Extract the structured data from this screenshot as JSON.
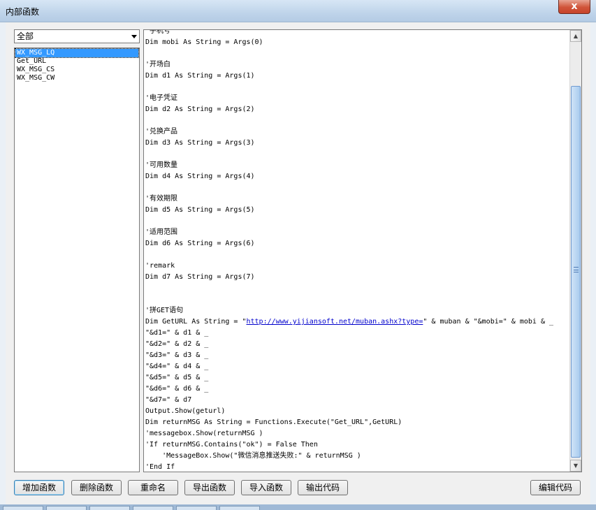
{
  "window": {
    "title": "内部函数",
    "close_label": "x"
  },
  "filter": {
    "selected": "全部"
  },
  "functions": [
    {
      "label": "WX_MSG_LQ",
      "selected": true
    },
    {
      "label": "Get_URL",
      "selected": false
    },
    {
      "label": "WX_MSG_CS",
      "selected": false
    },
    {
      "label": "WX_MSG_CW",
      "selected": false
    }
  ],
  "code_lines": [
    "'手机号",
    "Dim mobi As String = Args(0)",
    "",
    "'开场白",
    "Dim d1 As String = Args(1)",
    "",
    "'电子凭证",
    "Dim d2 As String = Args(2)",
    "",
    "'兑换产品",
    "Dim d3 As String = Args(3)",
    "",
    "'可用数量",
    "Dim d4 As String = Args(4)",
    "",
    "'有效期限",
    "Dim d5 As String = Args(5)",
    "",
    "'适用范围",
    "Dim d6 As String = Args(6)",
    "",
    "'remark",
    "Dim d7 As String = Args(7)",
    "",
    "",
    "'拼GET语句",
    "@URLLINE",
    "\"&d1=\" & d1 & _",
    "\"&d2=\" & d2 & _",
    "\"&d3=\" & d3 & _",
    "\"&d4=\" & d4 & _",
    "\"&d5=\" & d5 & _",
    "\"&d6=\" & d6 & _",
    "\"&d7=\" & d7",
    "Output.Show(geturl)",
    "Dim returnMSG As String = Functions.Execute(\"Get_URL\",GetURL)",
    "'messagebox.Show(returnMSG )",
    "'If returnMSG.Contains(\"ok\") = False Then",
    "    'MessageBox.Show(\"微信消息推送失败:\" & returnMSG )",
    "'End If"
  ],
  "url_line": {
    "prefix": "Dim GetURL As String = \"",
    "url": "http://www.yijiansoft.net/muban.ashx?type=",
    "suffix": "\" & muban & \"&mobi=\" & mobi & _"
  },
  "buttons": {
    "add": "增加函数",
    "delete": "删除函数",
    "rename": "重命名",
    "export": "导出函数",
    "import": "导入函数",
    "output": "输出代码",
    "edit": "编辑代码"
  },
  "scrollbar": {
    "up_icon": "▲",
    "down_icon": "▼"
  }
}
